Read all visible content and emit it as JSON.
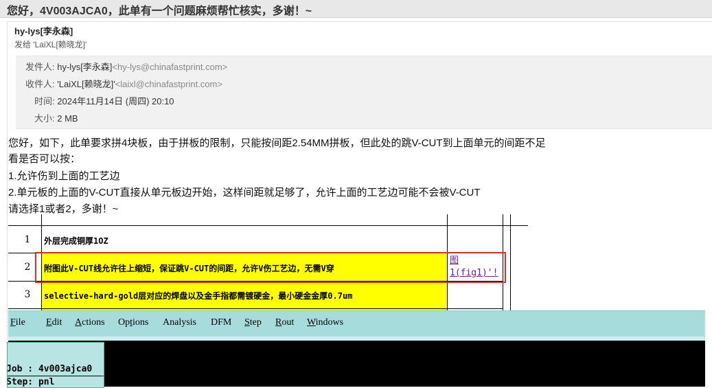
{
  "subject": "您好，4V003AJCA0，此单有一个问题麻烦帮忙核实，多谢！~",
  "sender": {
    "name": "hy-lys[李永森]",
    "sent_to": "发给 'LaiXL[赖晓龙]'"
  },
  "meta": {
    "from_label": "发件人:",
    "from_name": "hy-lys[李永森]",
    "from_addr": "<hy-lys@chinafastprint.com>",
    "to_label": "收件人:",
    "to_name": "'LaiXL[赖晓龙]'",
    "to_addr": "<laixl@chinafastprint.com>",
    "time_label": "时间:",
    "time_value": "2024年11月14日 (周四) 20:10",
    "size_label": "大小:",
    "size_value": "2 MB"
  },
  "body": {
    "line1": "您好，如下，此单要求拼4块板，由于拼板的限制，只能按间距2.54MM拼板，但此处的跳V-CUT到上面单元的间距不足",
    "line2": "看是否可以按：",
    "line3": "1.允许伤到上面的工艺边",
    "line4": "2.单元板的上面的V-CUT直接从单元板边开始，这样间距就足够了，允许上面的工艺边可能不会被V-CUT",
    "line5": "请选择1或者2，多谢！~"
  },
  "table": {
    "rows": [
      {
        "num": "1",
        "text": "外层完成铜厚1OZ",
        "note": ""
      },
      {
        "num": "2",
        "text": "附图此V-CUT线允许往上缩短，保证跳V-CUT的间距，允许V伤工艺边，无需V穿",
        "note_line1": "图",
        "note_line2": "1(fig1)'!"
      },
      {
        "num": "3",
        "text": "selective-hard-gold层对应的焊盘以及金手指都需镀硬金，最小硬金金厚0.7um",
        "note": ""
      }
    ]
  },
  "app": {
    "menu": [
      {
        "pre": "",
        "u": "F",
        "post": "ile"
      },
      {
        "pre": "",
        "u": "E",
        "post": "dit"
      },
      {
        "pre": "",
        "u": "A",
        "post": "ctions"
      },
      {
        "pre": "Op",
        "u": "t",
        "post": "ions"
      },
      {
        "pre": "Analysis",
        "u": "",
        "post": ""
      },
      {
        "pre": "DFM",
        "u": "",
        "post": ""
      },
      {
        "pre": "",
        "u": "S",
        "post": "tep"
      },
      {
        "pre": "",
        "u": "R",
        "post": "out"
      },
      {
        "pre": "",
        "u": "W",
        "post": "indows"
      }
    ],
    "job_line": "Job : 4v003ajca0",
    "step_line": "Step: pnl"
  },
  "colors": {
    "highlight": "#ffff00",
    "menubar": "#a6dcdc",
    "red_box": "#d32f2f",
    "link": "#6a1b9a"
  }
}
